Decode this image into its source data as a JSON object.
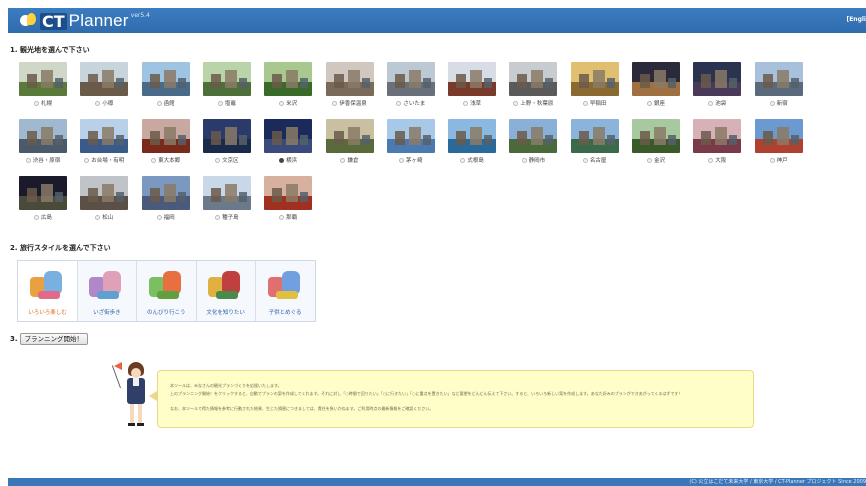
{
  "header": {
    "logo_ct": "CT",
    "logo_planner": "Planner",
    "logo_version": "ver5.4",
    "lang_link": "[Engli"
  },
  "colors": {
    "header_blue": "#3376ba",
    "selected_style": "#e06a1a",
    "style_label": "#2a5fa8",
    "bubble_bg": "#fffdc8"
  },
  "section1": {
    "title": "1. 観光地を選んで下さい"
  },
  "destinations": [
    {
      "name": "札幌",
      "selected": false,
      "sky": "#cfd8c8",
      "ground": "#5a7a3a"
    },
    {
      "name": "小樽",
      "selected": false,
      "sky": "#c8d4dc",
      "ground": "#6a5a48"
    },
    {
      "name": "函館",
      "selected": false,
      "sky": "#9ec4e4",
      "ground": "#4a6a8a"
    },
    {
      "name": "塩竈",
      "selected": false,
      "sky": "#b8d4a8",
      "ground": "#4e6e3a"
    },
    {
      "name": "米沢",
      "selected": false,
      "sky": "#a8c890",
      "ground": "#3a6a2a"
    },
    {
      "name": "伊香保温泉",
      "selected": false,
      "sky": "#d0c8c0",
      "ground": "#7a6a5a"
    },
    {
      "name": "さいたま",
      "selected": false,
      "sky": "#bcc8d4",
      "ground": "#6a707a"
    },
    {
      "name": "浅草",
      "selected": false,
      "sky": "#d8dce4",
      "ground": "#7a3a2a"
    },
    {
      "name": "上野・秋葉原",
      "selected": false,
      "sky": "#c8ccd0",
      "ground": "#5a5a5a"
    },
    {
      "name": "早稲田",
      "selected": false,
      "sky": "#e0c070",
      "ground": "#8a6a30"
    },
    {
      "name": "銀座",
      "selected": false,
      "sky": "#2a2a3a",
      "ground": "#a07040"
    },
    {
      "name": "池袋",
      "selected": false,
      "sky": "#2a3450",
      "ground": "#4a3a5a"
    },
    {
      "name": "新宿",
      "selected": false,
      "sky": "#a8c0dc",
      "ground": "#5a6a7a"
    },
    {
      "name": "渋谷・原宿",
      "selected": false,
      "sky": "#a0b8d0",
      "ground": "#4a5a6a"
    },
    {
      "name": "お台場・有明",
      "selected": false,
      "sky": "#b8d0e8",
      "ground": "#3a5a8a"
    },
    {
      "name": "東大本郷",
      "selected": false,
      "sky": "#c8a8a0",
      "ground": "#7a2a1a"
    },
    {
      "name": "文京区",
      "selected": false,
      "sky": "#2a3a6a",
      "ground": "#1a2a4a"
    },
    {
      "name": "横浜",
      "selected": true,
      "sky": "#1a2a5a",
      "ground": "#3a4a7a"
    },
    {
      "name": "鎌倉",
      "selected": false,
      "sky": "#c8c0a0",
      "ground": "#5a6a3a"
    },
    {
      "name": "茅ヶ崎",
      "selected": false,
      "sky": "#a8c8e8",
      "ground": "#4a7ab0"
    },
    {
      "name": "式根島",
      "selected": false,
      "sky": "#8ab8e0",
      "ground": "#2a6a9a"
    },
    {
      "name": "静岡市",
      "selected": false,
      "sky": "#8ab0d8",
      "ground": "#4a6a3a"
    },
    {
      "name": "名古屋",
      "selected": false,
      "sky": "#8ab4dc",
      "ground": "#3a6a4a"
    },
    {
      "name": "金沢",
      "selected": false,
      "sky": "#a8c8a0",
      "ground": "#3a5a2a"
    },
    {
      "name": "大阪",
      "selected": false,
      "sky": "#d8b0b8",
      "ground": "#7a3a4a"
    },
    {
      "name": "神戸",
      "selected": false,
      "sky": "#6a9ad0",
      "ground": "#b04030"
    },
    {
      "name": "広島",
      "selected": false,
      "sky": "#1a1a2a",
      "ground": "#4a4a3a"
    },
    {
      "name": "松山",
      "selected": false,
      "sky": "#c0c4c8",
      "ground": "#5a5048"
    },
    {
      "name": "福岡",
      "selected": false,
      "sky": "#7a98c0",
      "ground": "#4a5a7a"
    },
    {
      "name": "種子島",
      "selected": false,
      "sky": "#c8d8e8",
      "ground": "#6a7a8a"
    },
    {
      "name": "那覇",
      "selected": false,
      "sky": "#d8b0a0",
      "ground": "#a03020"
    }
  ],
  "section2": {
    "title": "2. 旅行スタイルを選んで下さい"
  },
  "styles": [
    {
      "label": "いろいろ楽しむ",
      "selected": true,
      "c1": "#e8a040",
      "c2": "#7ab0e0",
      "c3": "#e06a8a"
    },
    {
      "label": "いざ街歩き",
      "selected": false,
      "c1": "#b088c8",
      "c2": "#e0a0b8",
      "c3": "#60a0d0"
    },
    {
      "label": "のんびり行こう",
      "selected": false,
      "c1": "#7ac060",
      "c2": "#e87040",
      "c3": "#60a040"
    },
    {
      "label": "文化を知りたい",
      "selected": false,
      "c1": "#e0b040",
      "c2": "#c04040",
      "c3": "#4a8a4a"
    },
    {
      "label": "子供とめぐる",
      "selected": false,
      "c1": "#e07070",
      "c2": "#70a0e0",
      "c3": "#e0c040"
    }
  ],
  "section3": {
    "num": "3.",
    "button": "プランニング開始！"
  },
  "bubble": {
    "line1": "本ツールは、みなさんの観光プランづくりを応援いたします。",
    "line2": "上のプランニング開始！をクリックすると、自動でプランの案を作成してくれます。それに対し「○時間で回りたい」「○に行きたい」「○に重点を置きたい」など要望をどんどん伝えて下さい。すると、いろいろ新しい案を作成します。あなた好みのプランができあがってくるはずです！",
    "line3": "なお、本ツールで得た情報を参考に行動された結果、生じた損害につきましては、責任を負いかねます。ご利用時点の最新情報をご確認ください。"
  },
  "footer": {
    "text": "(C) 公立はこだて未来大学 / 東京大学 / CT-Planner プロジェクト  Since 2009"
  }
}
